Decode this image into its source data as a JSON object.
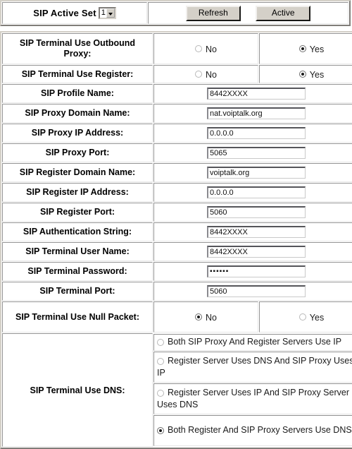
{
  "header": {
    "active_set_label": "SIP Active Set",
    "active_set_value": "1",
    "active_set_options": [
      "1"
    ],
    "refresh_label": "Refresh",
    "active_label": "Active"
  },
  "options": {
    "no": "No",
    "yes": "Yes"
  },
  "rows": [
    {
      "label": "SIP Terminal Use Outbound Proxy:",
      "type": "radio2",
      "selected": "Yes"
    },
    {
      "label": "SIP Terminal Use Register:",
      "type": "radio2",
      "selected": "Yes"
    },
    {
      "label": "SIP Profile Name:",
      "type": "text",
      "value": "8442XXXX"
    },
    {
      "label": "SIP Proxy Domain Name:",
      "type": "text",
      "value": "nat.voiptalk.org"
    },
    {
      "label": "SIP Proxy IP Address:",
      "type": "text",
      "value": "0.0.0.0"
    },
    {
      "label": "SIP Proxy Port:",
      "type": "text",
      "value": "5065"
    },
    {
      "label": "SIP Register Domain Name:",
      "type": "text",
      "value": "voiptalk.org"
    },
    {
      "label": "SIP Register IP Address:",
      "type": "text",
      "value": "0.0.0.0"
    },
    {
      "label": "SIP Register Port:",
      "type": "text",
      "value": "5060"
    },
    {
      "label": "SIP Authentication String:",
      "type": "text",
      "value": "8442XXXX"
    },
    {
      "label": "SIP Terminal User Name:",
      "type": "text",
      "value": "8442XXXX"
    },
    {
      "label": "SIP Terminal Password:",
      "type": "password",
      "value": "▪▪▪▪▪▪"
    },
    {
      "label": "SIP Terminal Port:",
      "type": "text",
      "value": "5060"
    },
    {
      "label": "SIP Terminal Use Null Packet:",
      "type": "radio2",
      "selected": "No"
    }
  ],
  "dns": {
    "label": "SIP Terminal Use DNS:",
    "options": [
      {
        "text": "Both SIP Proxy And Register Servers Use IP",
        "selected": false
      },
      {
        "text": "Register Server Uses DNS And SIP Proxy Uses IP",
        "selected": false
      },
      {
        "text": "Register Server Uses IP And SIP Proxy Server Uses DNS",
        "selected": false
      },
      {
        "text": "Both Register And SIP Proxy Servers Use DNS",
        "selected": true
      }
    ]
  },
  "colors": {
    "button_face": "#d4d0c8",
    "page_background": "#ffffff",
    "text": "#000000"
  }
}
